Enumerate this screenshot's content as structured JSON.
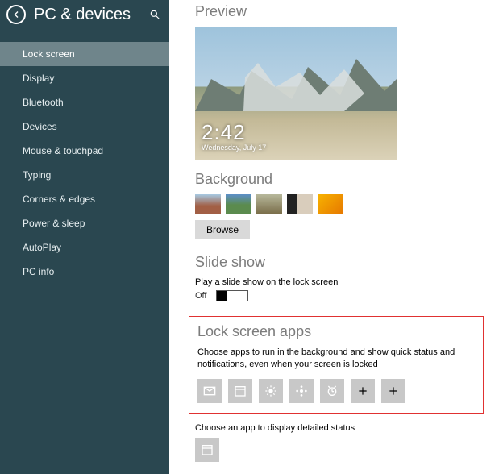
{
  "sidebar": {
    "title": "PC & devices",
    "items": [
      {
        "label": "Lock screen",
        "selected": true
      },
      {
        "label": "Display"
      },
      {
        "label": "Bluetooth"
      },
      {
        "label": "Devices"
      },
      {
        "label": "Mouse & touchpad"
      },
      {
        "label": "Typing"
      },
      {
        "label": "Corners & edges"
      },
      {
        "label": "Power & sleep"
      },
      {
        "label": "AutoPlay"
      },
      {
        "label": "PC info"
      }
    ]
  },
  "preview": {
    "heading": "Preview",
    "clock_time": "2:42",
    "clock_date": "Wednesday, July 17"
  },
  "background": {
    "heading": "Background",
    "browse_label": "Browse"
  },
  "slideshow": {
    "heading": "Slide show",
    "description": "Play a slide show on the lock screen",
    "state": "Off"
  },
  "apps": {
    "heading": "Lock screen apps",
    "description": "Choose apps to run in the background and show quick status and notifications, even when your screen is locked"
  },
  "detailed": {
    "description": "Choose an app to display detailed status"
  }
}
